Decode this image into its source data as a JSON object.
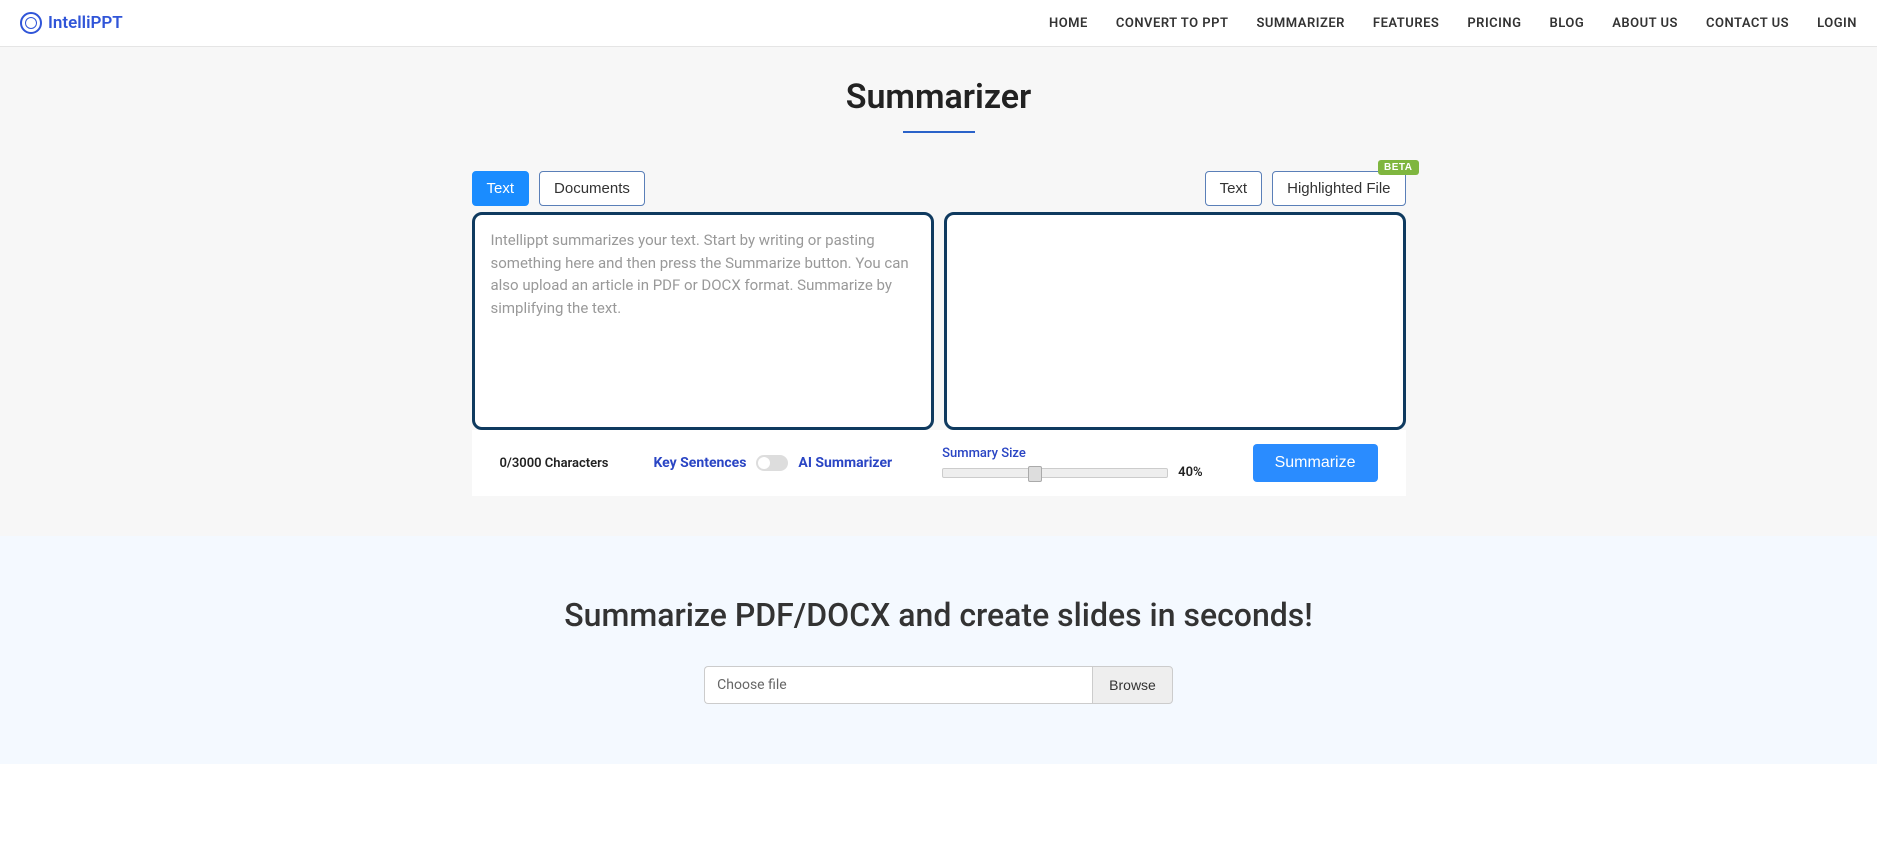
{
  "logo": "IntelliPPT",
  "nav": [
    "HOME",
    "CONVERT TO PPT",
    "SUMMARIZER",
    "FEATURES",
    "PRICING",
    "BLOG",
    "ABOUT US",
    "CONTACT US",
    "LOGIN"
  ],
  "page_title": "Summarizer",
  "tabs_left": {
    "text": "Text",
    "documents": "Documents"
  },
  "tabs_right": {
    "text": "Text",
    "highlighted": "Highlighted File",
    "badge": "BETA"
  },
  "input_placeholder": "Intellippt summarizes your text. Start by writing or pasting something here and then press the Summarize button. You can also upload an article in PDF or DOCX format. Summarize by simplifying the text.",
  "char_count": "0/3000 Characters",
  "mode": {
    "left": "Key Sentences",
    "right": "AI Summarizer"
  },
  "slider": {
    "label": "Summary Size",
    "value": "40%"
  },
  "summarize_btn": "Summarize",
  "section2_title": "Summarize PDF/DOCX and create slides in seconds!",
  "file": {
    "placeholder": "Choose file",
    "browse": "Browse"
  }
}
